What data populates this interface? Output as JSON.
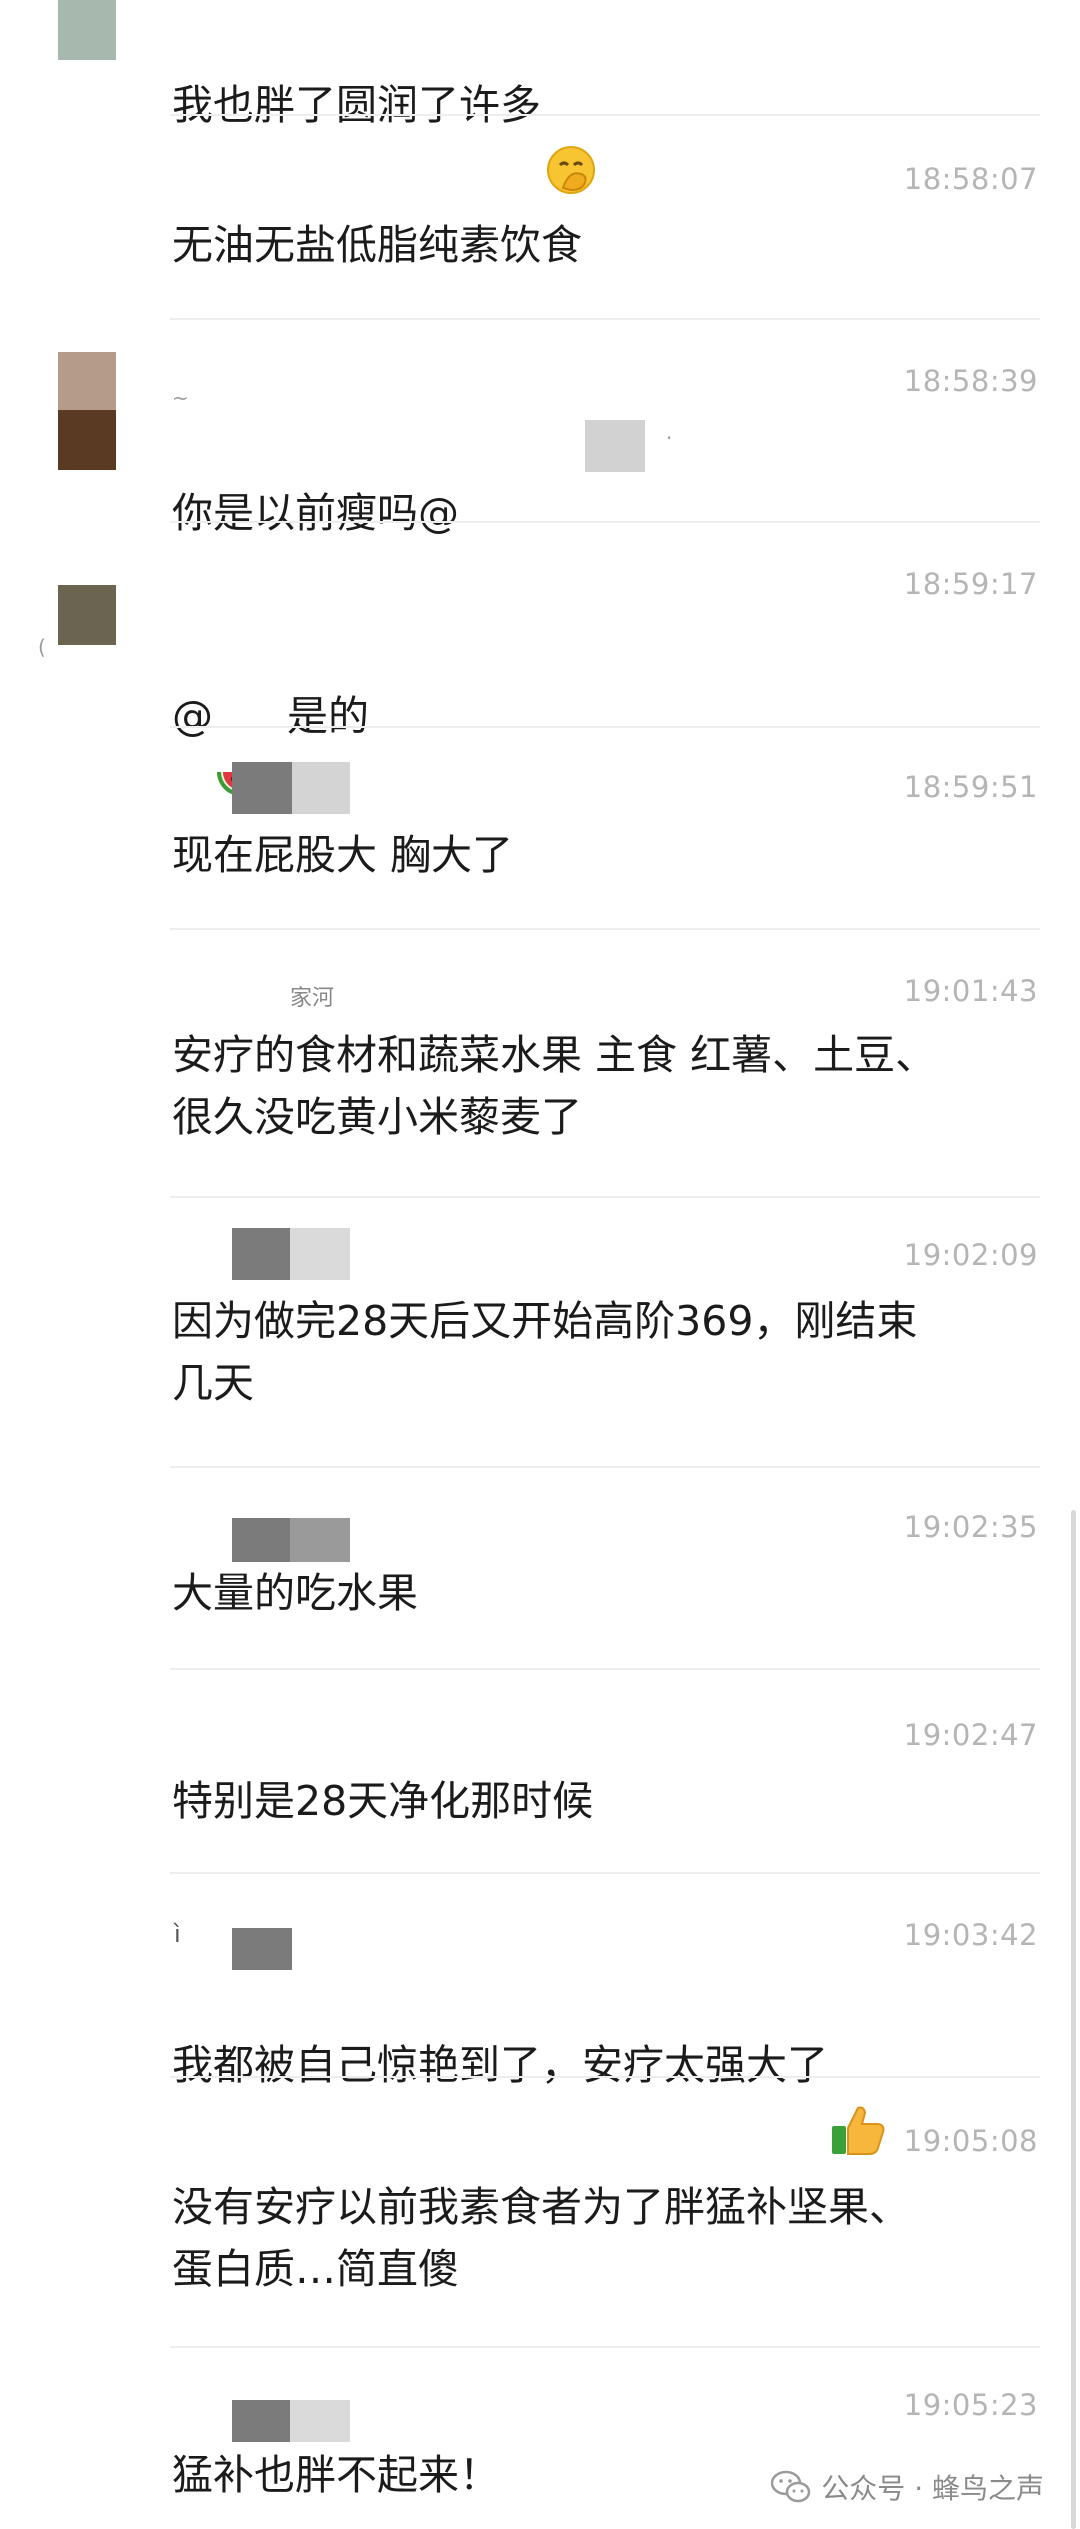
{
  "messages": [
    {
      "time": "",
      "text": "我也胖了圆润了许多",
      "emoji": "hand-over-mouth-emoji"
    },
    {
      "time": "18:58:07",
      "text": "无油无盐低脂纯素饮食"
    },
    {
      "time": "18:58:39",
      "text": "你是以前瘦吗@"
    },
    {
      "time": "18:59:17",
      "text": "是的",
      "mention_prefix": "@",
      "emoji": "watermelon-emoji"
    },
    {
      "time": "18:59:51",
      "text": "现在屁股大 胸大了"
    },
    {
      "time": "19:01:43",
      "text": "安疗的食材和蔬菜水果 主食 红薯、土豆、\n很久没吃黄小米藜麦了",
      "sender_fragment": "家河"
    },
    {
      "time": "19:02:09",
      "text": "因为做完28天后又开始高阶369，刚结束\n几天"
    },
    {
      "time": "19:02:35",
      "text": "大量的吃水果"
    },
    {
      "time": "19:02:47",
      "text": "特别是28天净化那时候"
    },
    {
      "time": "19:03:42",
      "text": "我都被自己惊艳到了，安疗太强大了",
      "emoji": "thumbs-up-emoji"
    },
    {
      "time": "19:05:08",
      "text": "没有安疗以前我素食者为了胖猛补坚果、\n蛋白质…简直傻"
    },
    {
      "time": "19:05:23",
      "text": "猛补也胖不起来！"
    }
  ],
  "watermark": {
    "icon": "wechat-icon",
    "text": "公众号 · 蜂鸟之声"
  },
  "colors": {
    "background": "#ffffff",
    "text": "#1b1b1b",
    "timestamp": "#b5b5b5",
    "divider": "#ededed",
    "redaction_dark": "#7b7b7b",
    "redaction_light": "#d4d4d4"
  }
}
